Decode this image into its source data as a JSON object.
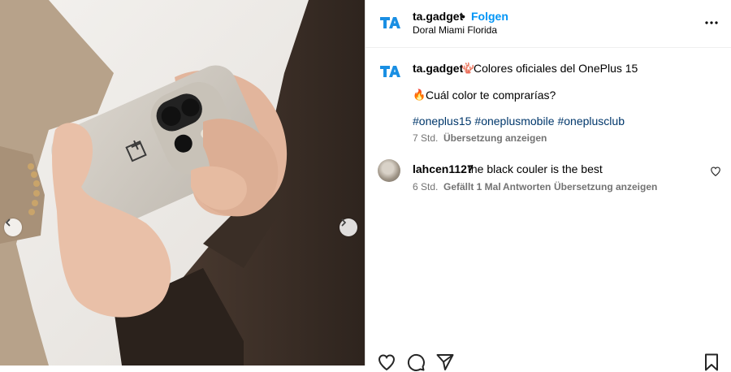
{
  "post": {
    "username": "ta.gadget",
    "separator": "•",
    "follow_label": "Folgen",
    "location": "Doral Miami Florida"
  },
  "caption": {
    "username": "ta.gadget",
    "emoji_1": "🪸",
    "title": "Colores oficiales del OnePlus 15",
    "emoji_2": "🔥",
    "question": "Cuál color te comprarías?",
    "hashtags": [
      "#oneplus15",
      "#oneplusmobile",
      "#oneplusclub"
    ],
    "time": "7 Std.",
    "translate_label": "Übersetzung anzeigen"
  },
  "comments": [
    {
      "username": "lahcen1127",
      "text": "the black couler is the best",
      "time": "6 Std.",
      "likes_label": "Gefällt 1 Mal",
      "reply_label": "Antworten",
      "translate_label": "Übersetzung anzeigen"
    }
  ],
  "colors": {
    "accent": "#0095f6",
    "hashtag": "#00376b",
    "secondary_text": "#737373",
    "ta_logo": "#1a8fe3"
  },
  "icons": {
    "media_prev": "chevron-left-icon",
    "media_next": "chevron-right-icon",
    "more": "more-horizontal-icon",
    "like": "heart-icon",
    "comment": "comment-icon",
    "share": "send-icon",
    "save": "bookmark-icon"
  }
}
